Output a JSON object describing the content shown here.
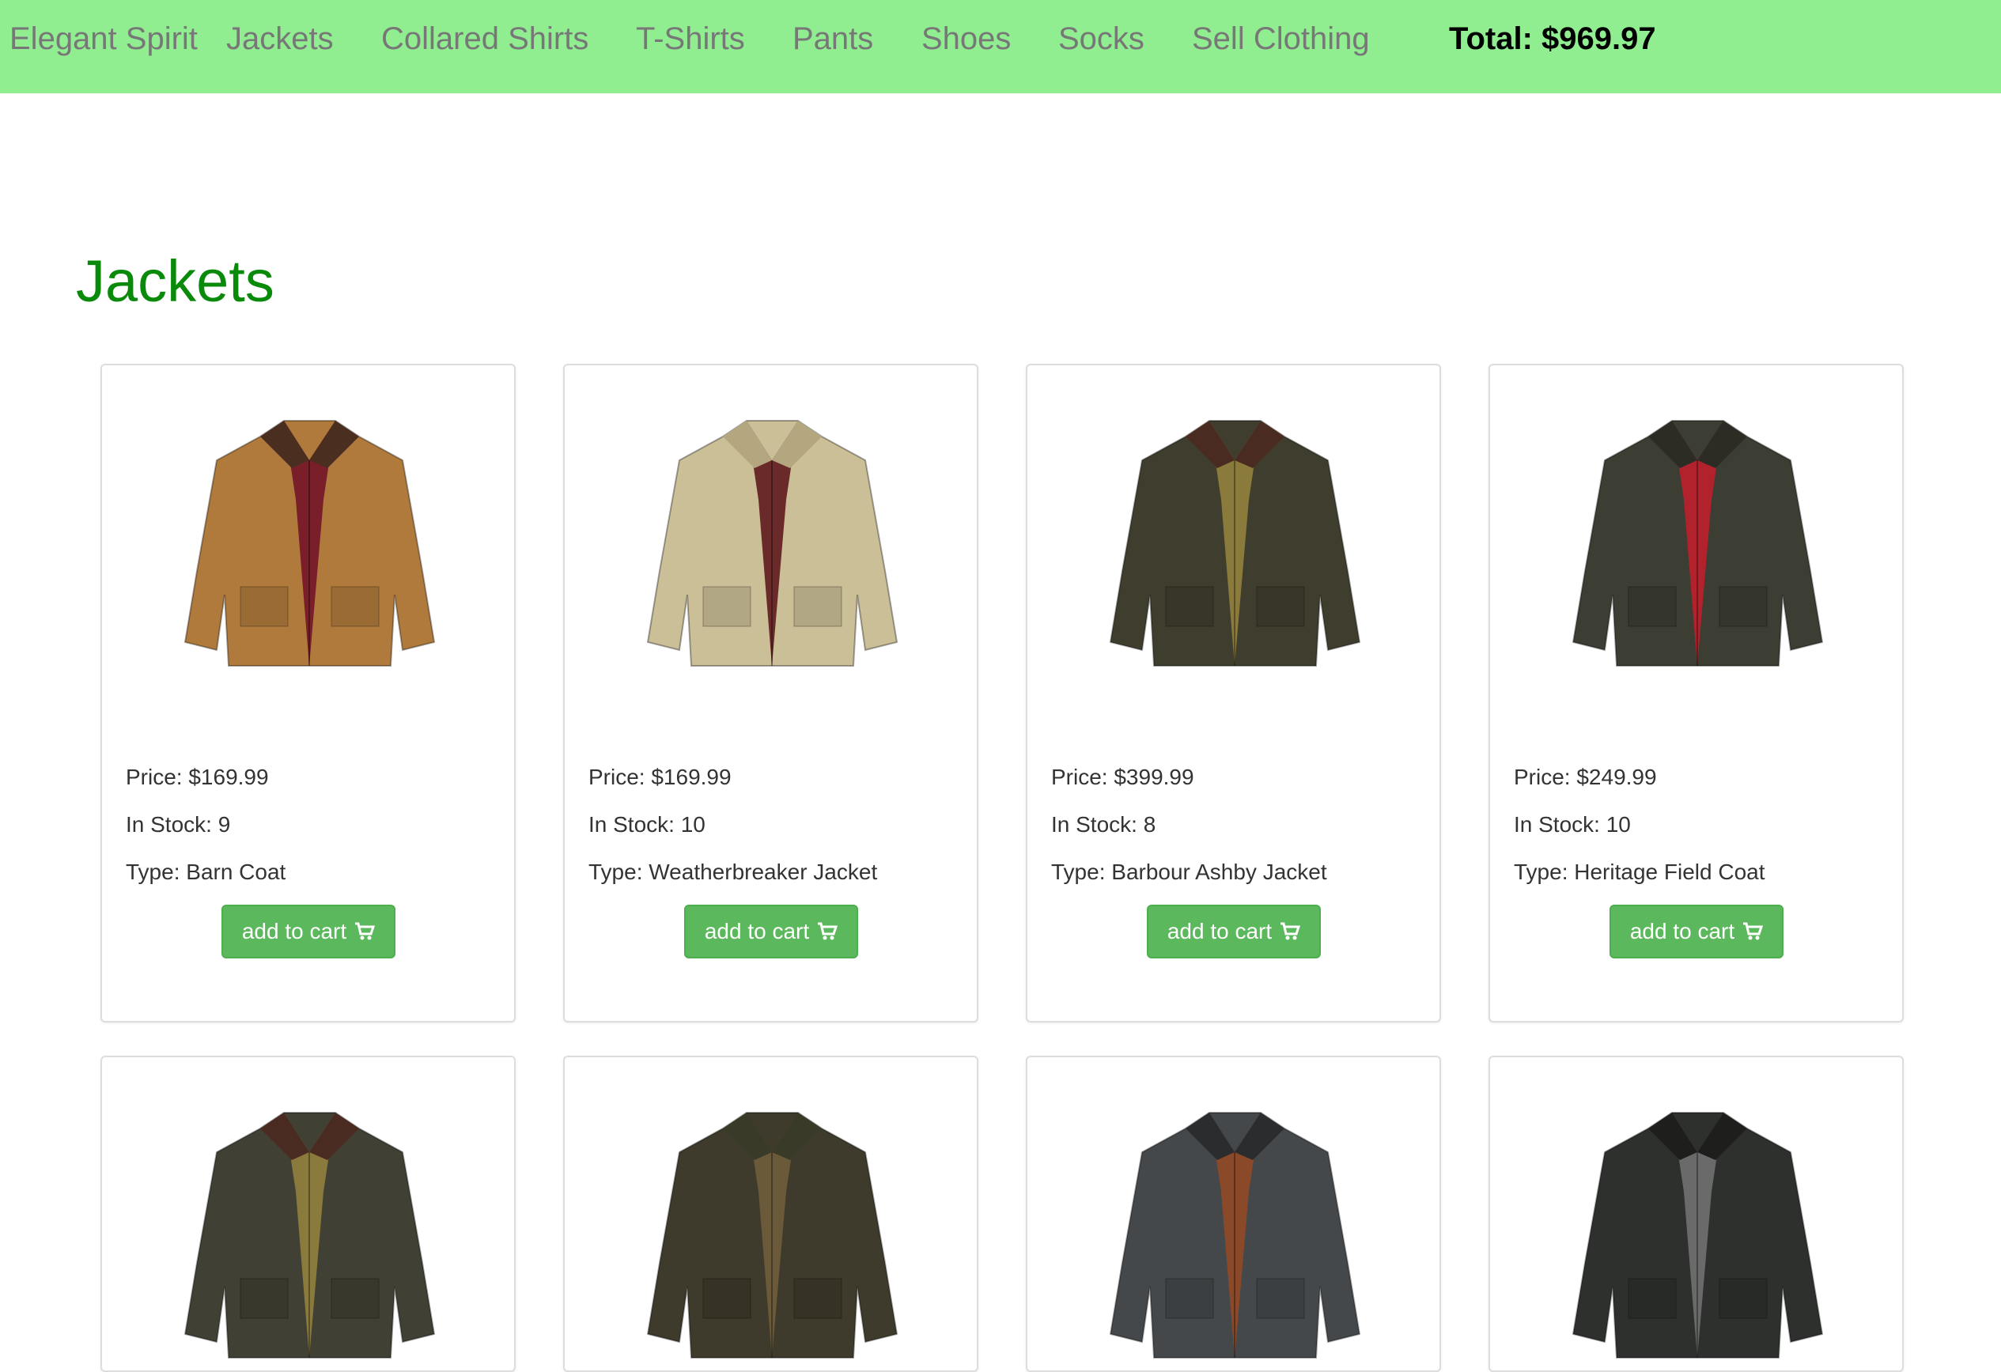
{
  "nav": {
    "brand": "Elegant Spirit",
    "links": [
      "Jackets",
      "Collared Shirts",
      "T-Shirts",
      "Pants",
      "Shoes",
      "Socks",
      "Sell Clothing"
    ],
    "total": "Total: $969.97",
    "background": "#90ee90"
  },
  "page": {
    "title": "Jackets",
    "title_color": "#0a8a0a"
  },
  "button_color": "#5cb85c",
  "products": [
    {
      "price": "Price: $169.99",
      "stock": "In Stock: 9",
      "type": "Type: Barn Coat",
      "button": "add to cart",
      "icon": "cart-icon",
      "body_color": "#b07a3c",
      "collar_color": "#4a2e20",
      "lining_color": "#7a1f2a"
    },
    {
      "price": "Price: $169.99",
      "stock": "In Stock: 10",
      "type": "Type: Weatherbreaker Jacket",
      "button": "add to cart",
      "icon": "cart-icon",
      "body_color": "#cbbf98",
      "collar_color": "#b4a780",
      "lining_color": "#6a2a2a"
    },
    {
      "price": "Price: $399.99",
      "stock": "In Stock: 8",
      "type": "Type: Barbour Ashby Jacket",
      "button": "add to cart",
      "icon": "cart-icon",
      "body_color": "#3f3e2e",
      "collar_color": "#4a2b22",
      "lining_color": "#8a7a3c"
    },
    {
      "price": "Price: $249.99",
      "stock": "In Stock: 10",
      "type": "Type: Heritage Field Coat",
      "button": "add to cart",
      "icon": "cart-icon",
      "body_color": "#3c3d33",
      "collar_color": "#2c2c25",
      "lining_color": "#b2222c"
    }
  ],
  "products_row2": [
    {
      "body_color": "#404034",
      "collar_color": "#4a2b22",
      "lining_color": "#8a7a3c"
    },
    {
      "body_color": "#3e3a2c",
      "collar_color": "#3a3a28",
      "lining_color": "#6a5a3a"
    },
    {
      "body_color": "#45484a",
      "collar_color": "#2a2c2e",
      "lining_color": "#8a4a2a"
    },
    {
      "body_color": "#2e302e",
      "collar_color": "#1e1e1c",
      "lining_color": "#6a6a6a"
    }
  ]
}
